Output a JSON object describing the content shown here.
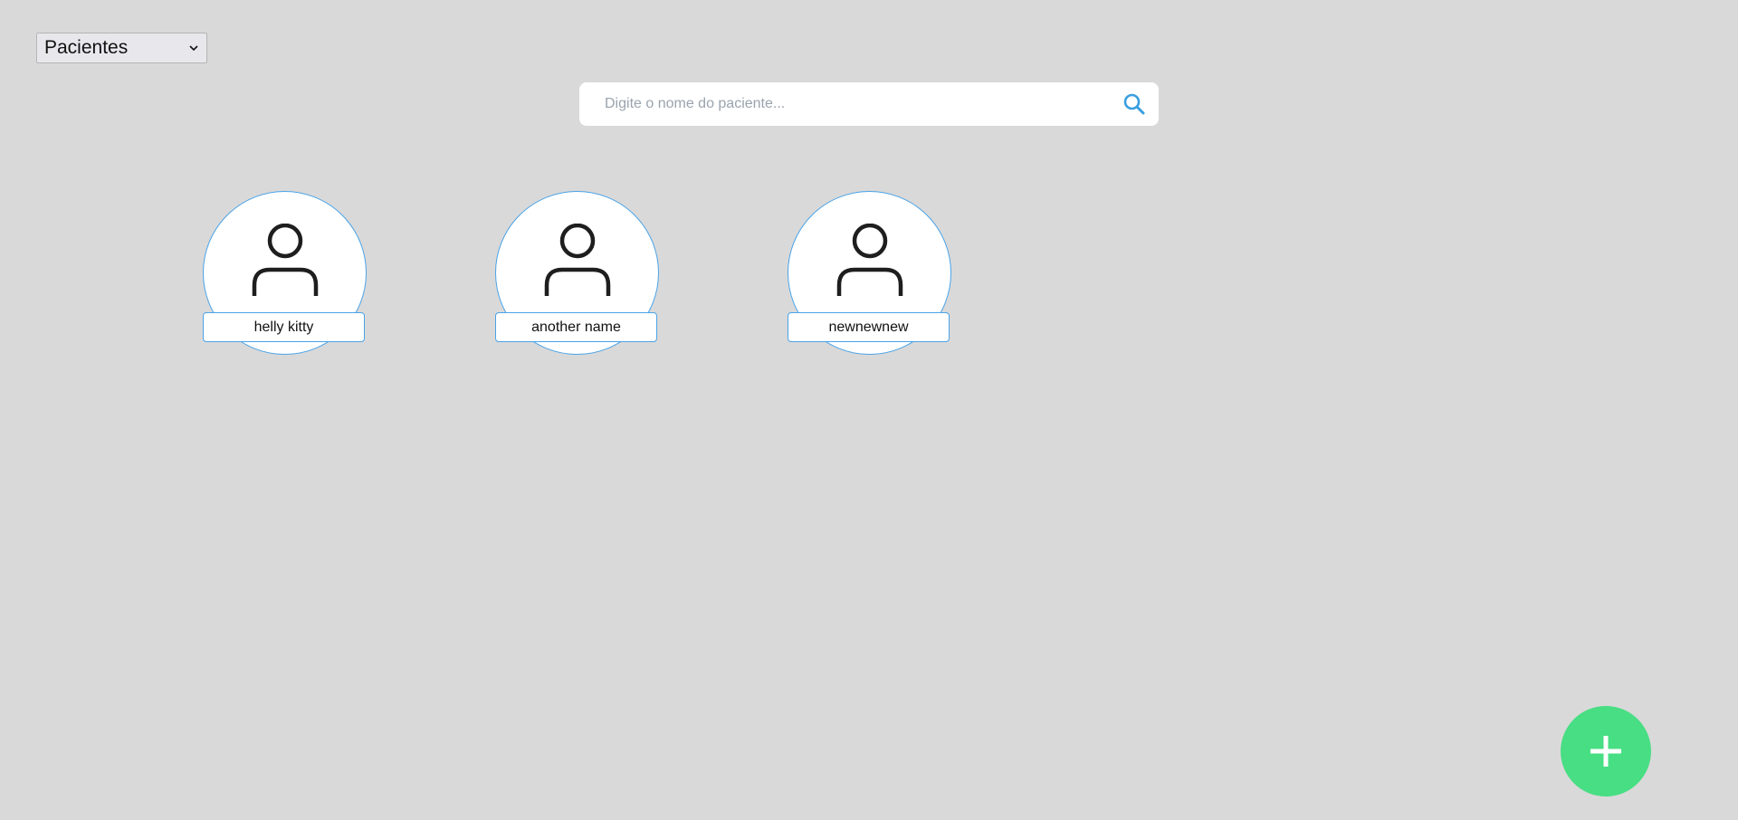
{
  "filter": {
    "selected": "Pacientes"
  },
  "search": {
    "placeholder": "Digite o nome do paciente...",
    "value": ""
  },
  "patients": [
    {
      "name": "helly kitty"
    },
    {
      "name": "another name"
    },
    {
      "name": "newnewnew"
    }
  ],
  "colors": {
    "background": "#d9d9d9",
    "accent_blue": "#4aa3e8",
    "add_button_green": "#48de83"
  },
  "icons": {
    "search": "search-icon",
    "patient": "person-icon",
    "add": "plus-icon",
    "dropdown": "chevron-down-icon"
  }
}
